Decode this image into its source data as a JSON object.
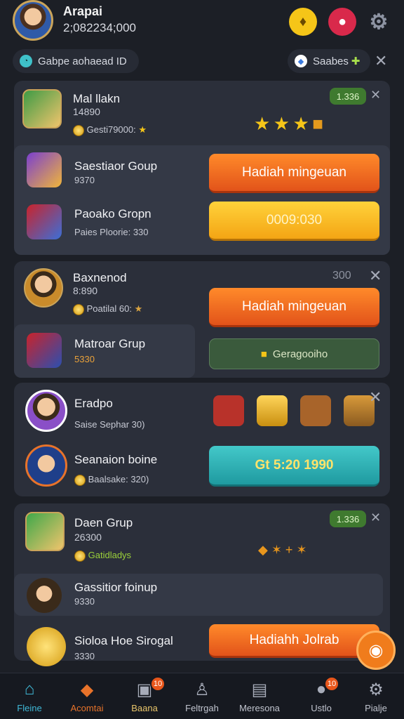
{
  "header": {
    "name": "Arapai",
    "subtitle": "2;082234;000"
  },
  "chips": {
    "left": "Gabpe aohaead ID",
    "right": "Saabes"
  },
  "groups": [
    {
      "name": "Mal llakn",
      "number": "14890",
      "detail": "Gesti79000:",
      "badge": "1.336",
      "subs": [
        {
          "name": "Saestiaor Goup",
          "value": "9370",
          "button": "Hadiah mingeuan"
        },
        {
          "name": "Paoako Gropn",
          "value": "Paies Ploorie: 330",
          "button": "0009:030"
        }
      ]
    },
    {
      "name": "Baxnenod",
      "number": "8:890",
      "detail": "Poatilal 60:",
      "badge": "300",
      "subs": [
        {
          "name": "Matroar Grup",
          "value": "5330",
          "button": "Hadiah mingeuan",
          "button2": "Geragooiho"
        }
      ]
    },
    {
      "name": "Eradpo",
      "number": "",
      "detail": "Saise Sephar 30)",
      "subs": [
        {
          "name": "Seanaion boine",
          "value": "Baalsake: 320)",
          "button": "Gt 5:20 1990"
        }
      ]
    },
    {
      "name": "Daen Grup",
      "number": "26300",
      "detail": "Gatidladys",
      "badge": "1.336",
      "subs": [
        {
          "name": "Gassitior foinup",
          "value": "9330"
        },
        {
          "name": "Sioloa Hoe Sirogal",
          "value": "3330",
          "button": "Hadiahh Jolrab"
        }
      ]
    }
  ],
  "bottom_nav": [
    {
      "label": "Fleine",
      "icon": "home-icon",
      "active": true
    },
    {
      "label": "Acomtai",
      "icon": "tag-icon",
      "badge": ""
    },
    {
      "label": "Baana",
      "icon": "briefcase-icon",
      "badge": "10"
    },
    {
      "label": "Feltrgah",
      "icon": "person-icon"
    },
    {
      "label": "Meresona",
      "icon": "document-icon"
    },
    {
      "label": "Ustlo",
      "icon": "chat-icon",
      "badge": "10"
    },
    {
      "label": "Pialje",
      "icon": "gear-icon"
    }
  ]
}
